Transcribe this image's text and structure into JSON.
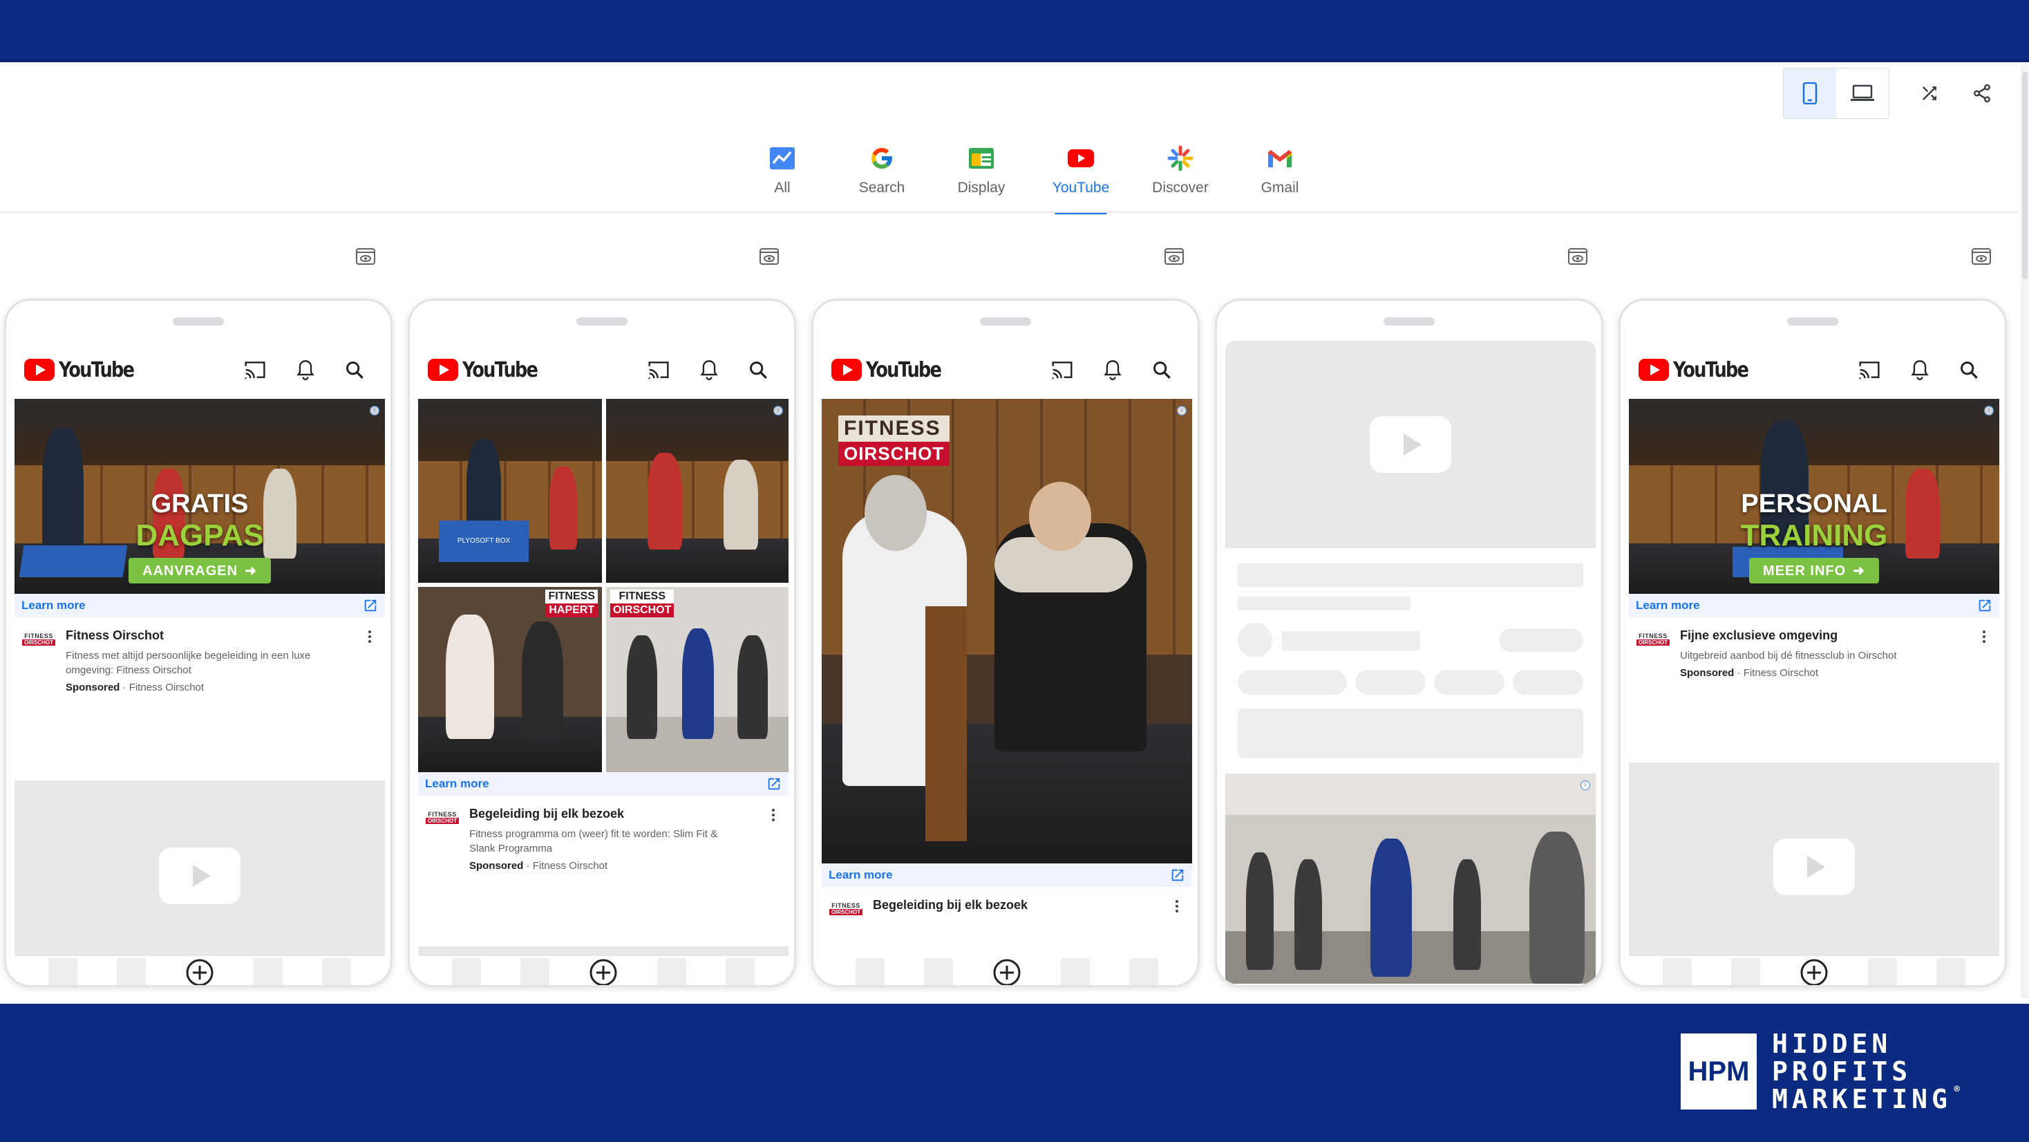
{
  "brand": {
    "hpm_mark": "HPM",
    "hpm_lines": [
      "HIDDEN",
      "PROFITS",
      "MARKETING"
    ],
    "registered": "®",
    "colors": {
      "band": "#0b2a82",
      "accent": "#1a73e8",
      "green_cta": "#7cc242",
      "yt_red": "#ff0000"
    }
  },
  "toolbar": {
    "buttons": [
      {
        "icon": "phone-icon",
        "active": true
      },
      {
        "icon": "laptop-icon",
        "active": false
      },
      {
        "icon": "shuffle-icon",
        "active": false
      },
      {
        "icon": "share-icon",
        "active": false
      }
    ]
  },
  "tabs": [
    {
      "label": "All",
      "icon": "all-icon",
      "active": false
    },
    {
      "label": "Search",
      "icon": "google-icon",
      "active": false
    },
    {
      "label": "Display",
      "icon": "display-icon",
      "active": false
    },
    {
      "label": "YouTube",
      "icon": "youtube-icon",
      "active": true
    },
    {
      "label": "Discover",
      "icon": "discover-icon",
      "active": false
    },
    {
      "label": "Gmail",
      "icon": "gmail-icon",
      "active": false
    }
  ],
  "youtube": {
    "wordmark": "YouTube"
  },
  "previews": [
    {
      "overlay_line1": "GRATIS",
      "overlay_line2": "DAGPAS",
      "cta": "AANVRAGEN",
      "learn_more": "Learn more",
      "advertiser_logo": [
        "FITNESS",
        "OIRSCHOT"
      ],
      "title": "Fitness Oirschot",
      "description": "Fitness met altijd persoonlijke begeleiding in een luxe omgeving: Fitness Oirschot",
      "sponsored": "Sponsored",
      "advertiser": "Fitness Oirschot"
    },
    {
      "collage_tags": [
        "FITNESS",
        "HAPERT",
        "FITNESS",
        "OIRSCHOT"
      ],
      "box_label": "PLYOSOFT BOX",
      "learn_more": "Learn more",
      "advertiser_logo": [
        "FITNESS",
        "OIRSCHOT"
      ],
      "title": "Begeleiding bij elk bezoek",
      "description": "Fitness programma om (weer) fit te worden: Slim Fit & Slank Programma",
      "sponsored": "Sponsored",
      "advertiser": "Fitness Oirschot"
    },
    {
      "sign_line1": "FITNESS",
      "sign_line2": "OIRSCHOT",
      "learn_more": "Learn more",
      "advertiser_logo": [
        "FITNESS",
        "OIRSCHOT"
      ],
      "title": "Begeleiding bij elk bezoek"
    },
    {
      "placeholder": true
    },
    {
      "overlay_line1": "PERSONAL",
      "overlay_line2": "TRAINING",
      "cta": "MEER INFO",
      "learn_more": "Learn more",
      "advertiser_logo": [
        "FITNESS",
        "OIRSCHOT"
      ],
      "title": "Fijne exclusieve omgeving",
      "description": "Uitgebreid aanbod bij dé fitnessclub in Oirschot",
      "sponsored": "Sponsored",
      "advertiser": "Fitness Oirschot"
    }
  ]
}
